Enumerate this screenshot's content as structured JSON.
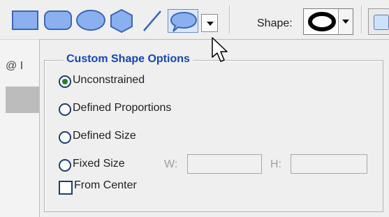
{
  "toolbar": {
    "shape_label": "Shape:",
    "tools": [
      "rectangle-tool",
      "rounded-rectangle-tool",
      "ellipse-tool",
      "polygon-tool",
      "line-tool",
      "custom-shape-tool"
    ],
    "selected_tool": "custom-shape-tool",
    "selected_shape_icon": "ellipse-ring-icon"
  },
  "left_strip": {
    "text": "@ I"
  },
  "panel": {
    "title": "Custom Shape Options",
    "options": [
      {
        "label": "Unconstrained",
        "checked": true
      },
      {
        "label": "Defined Proportions",
        "checked": false
      },
      {
        "label": "Defined Size",
        "checked": false
      },
      {
        "label": "Fixed Size",
        "checked": false
      }
    ],
    "width_label": "W:",
    "height_label": "H:",
    "width_value": "",
    "height_value": "",
    "from_center_label": "From Center"
  },
  "colors": {
    "legend_text": "#1446b8",
    "radio_checked": "#2b7b2b",
    "tool_fill": "#8ab0f0",
    "tool_stroke": "#3d67b4"
  }
}
